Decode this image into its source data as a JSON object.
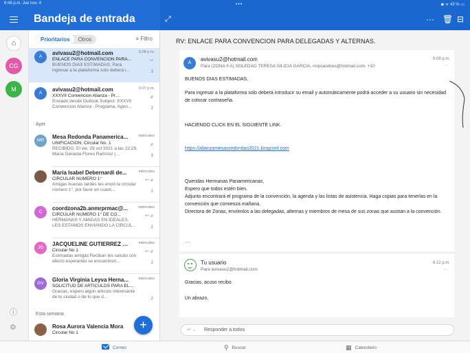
{
  "status_bar": {
    "time": "6:48 p.m.",
    "date": "Jue nov. 4",
    "battery": "43 %",
    "multitask_dots": "•••"
  },
  "app": {
    "title": "Bandeja de entrada"
  },
  "rail": {
    "accounts": [
      "CG",
      "M"
    ]
  },
  "list": {
    "tabs": {
      "focused": "Prioritarios",
      "other": "Otros"
    },
    "filter_label": "Filtro",
    "section_yesterday": "Ayer",
    "section_this_week": "Esta semana",
    "items": [
      {
        "avatar": "A",
        "color": "#3a7bd5",
        "from": "avivasu2@hotmail.com",
        "date": "6:08 p.m.",
        "subject": "ENLACE PARA CONVENCION PARA...",
        "preview": "BUENOS DIAS ESTIMADAS, Para ingresar a la plataforma solo deberá i...",
        "count": "3"
      },
      {
        "avatar": "A",
        "color": "#3a7bd5",
        "from": "avivasu2@hotmail.com",
        "date": "6:07 p.m.",
        "subject": "XXXVII Convencion Alianza - Pr...",
        "preview": "Enviado desde Outlook Subject: XXXVII Convencion Alianza - Programa, Agen...",
        "count": "2"
      },
      {
        "avatar": "MR",
        "color": "#6fa3c8",
        "from": "Mesa Redonda Panamerica...",
        "date": "miércoles",
        "subject": "UNIFICACIÓN, Circular No. 1",
        "preview": "RECIBIDO. El vie, 29 oct 2021 a las 22:29, María Gerarda Flores Ramírez (...",
        "count": "3"
      },
      {
        "avatar": "",
        "color": "#7a5a45",
        "from": "Maria Isabel Debernardi de...",
        "date": "miércoles",
        "subject": "CIRCULAR NÚMERO 1°",
        "preview": "Amigas buenas tardes les envió la circular número 1°, por favor en cuant...",
        "count": "2"
      },
      {
        "avatar": "C",
        "color": "#d36ad3",
        "from": "coordzona2b.anmrprmac@...",
        "date": "miércoles",
        "subject": "CIRCULAR NÚMERO 1° DE CO...",
        "preview": "HERMANAS Y AMIGAS EN IDEALES, LES ESTAMOS ENVIANDO LA CIRCUL...",
        "count": "2"
      },
      {
        "avatar": "JG",
        "color": "#e06bc1",
        "from": "JACQUELINE GUTIERREZ C...",
        "date": "miércoles",
        "subject": "Circular No 1",
        "preview": "Estimadas amigas Reciban les saludo con afecto esperando se encuentren...",
        "count": "2"
      },
      {
        "avatar": "GV",
        "color": "#9b6bd6",
        "from": "Gloria Virginia Leyva Herna...",
        "date": "miércoles",
        "subject": "SOLICITUD DE ARTICULOS PARA EL BO...",
        "preview": "Gracias, espero algún articulo interesante de tu ciudad o de lo que d...",
        "count": "2"
      },
      {
        "avatar": "",
        "color": "#8a6248",
        "from": "Rosa Aurora Valencia Mora",
        "date": "",
        "subject": "Circular No 1",
        "preview": "",
        "count": ""
      }
    ]
  },
  "reading": {
    "thread_title": "RV: ENLACE PARA CONVENCION PARA DELEGADAS Y ALTERNAS.",
    "message1": {
      "avatar": "A",
      "from": "avivasu2@hotmail.com",
      "to": "Para (ZONA II A) SOLEDAD TERESA SILICIA GARCIA, mrpsandres@hotmail.com, +10",
      "date": "6:08 p.m.",
      "more": "···",
      "greeting": "BUENOS DIAS ESTIMADAS,",
      "p1": "Para ingresar a la plataforma solo deberá introducir su email y automáticamente podrá acceder a su usuario sin necesidad de colocar contraseña.",
      "p2": "HACIENDO CLICK EN EL SIGUIENTE LINK.",
      "link": "https://alianzamesasredondas2021.kingconf.com",
      "p3_lines": [
        "Queridas Hermanas Panamericanas,",
        "Espero que todos estén bien.",
        "Adjunto encontrará el programa de la convención, la agenda y las listas de asistencia. Haga copias para tenerlas en la convención que comienza mañana.",
        "Directora de Zonas, envíenlos a las delegadas, alternas y miembros de mesa de sus zonas que asistan a la convención."
      ],
      "ellipsis": "···"
    },
    "message2": {
      "from": "Tu usuario",
      "to": "Para avivasu2@hotmail.com",
      "date": "6:12 p.m.",
      "more": "···",
      "line1": "Gracias, acuso recibo.",
      "line2": "Un abrazo,"
    },
    "reply_placeholder": "Responder a todos"
  },
  "tabbar": {
    "mail": "Correo",
    "search": "Buscar",
    "calendar": "Calendario"
  }
}
